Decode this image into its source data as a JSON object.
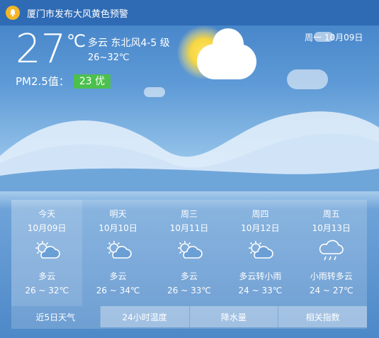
{
  "alert": {
    "text": "厦门市发布大风黄色预警",
    "icon": "bell-icon"
  },
  "current": {
    "temp": "27",
    "unit": "℃",
    "condition": "多云 东北风4-5 级",
    "range": "26~32℃",
    "date": "周一 10月09日",
    "pm_label": "PM2.5值：",
    "pm_value": "23 优",
    "pm_color": "#4cc04c"
  },
  "forecast": [
    {
      "name": "今天",
      "date": "10月09日",
      "weather": "多云",
      "temp": "26 ~ 32℃",
      "icon": "partly-cloudy-icon"
    },
    {
      "name": "明天",
      "date": "10月10日",
      "weather": "多云",
      "temp": "26 ~ 34℃",
      "icon": "partly-cloudy-icon"
    },
    {
      "name": "周三",
      "date": "10月11日",
      "weather": "多云",
      "temp": "26 ~ 33℃",
      "icon": "partly-cloudy-icon"
    },
    {
      "name": "周四",
      "date": "10月12日",
      "weather": "多云转小雨",
      "temp": "24 ~ 33℃",
      "icon": "partly-cloudy-icon"
    },
    {
      "name": "周五",
      "date": "10月13日",
      "weather": "小雨转多云",
      "temp": "24 ~ 27℃",
      "icon": "rain-cloud-icon"
    }
  ],
  "tabs": [
    "近5日天气",
    "24小时温度",
    "降水量",
    "相关指数"
  ]
}
